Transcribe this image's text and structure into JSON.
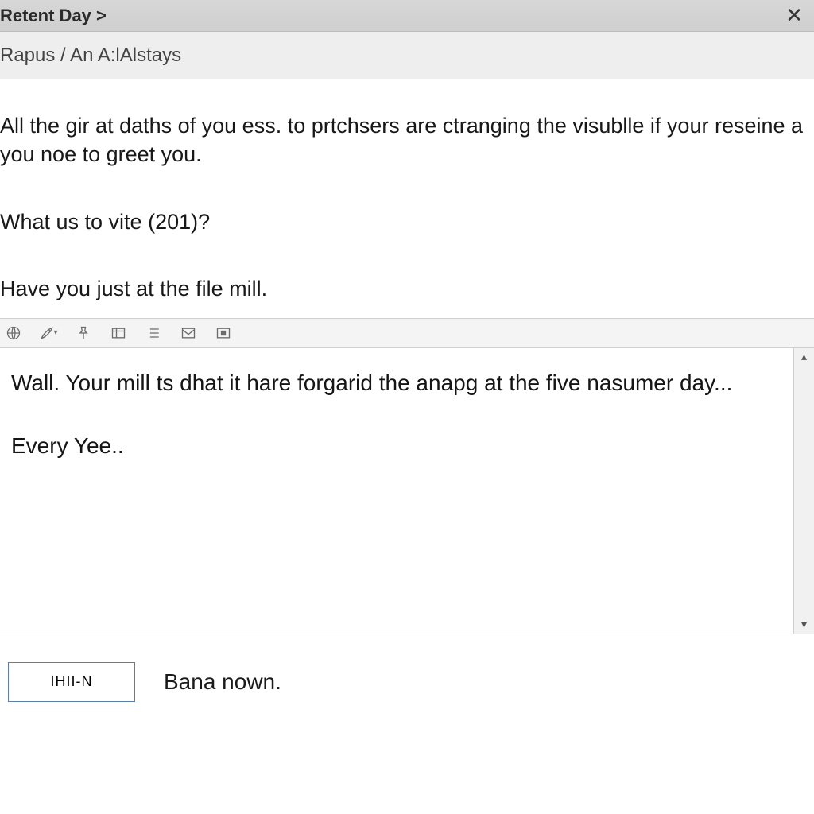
{
  "titlebar": {
    "title": "Retent Day >",
    "close_label": "✕"
  },
  "subbar": {
    "path": "Rapus / An A:lAlstays"
  },
  "body": {
    "p1": "All the gir at daths of you ess. to prtchsers are ctranging the visublle if your reseine a you noe to greet you.",
    "p2": "What us to vite (201)?",
    "p3": "Have you just at the file mill."
  },
  "toolbar": {
    "icons": [
      "globe-icon",
      "brush-icon",
      "pin-icon",
      "layout-icon",
      "list-icon",
      "mail-icon",
      "stop-icon"
    ]
  },
  "editor": {
    "line1": "Wall. Your mill ts dhat it hare forgarid the anapg at the five nasumer day...",
    "line2": "Every Yee.."
  },
  "footer": {
    "button_label": "IHII-N",
    "text": "Bana nown."
  }
}
